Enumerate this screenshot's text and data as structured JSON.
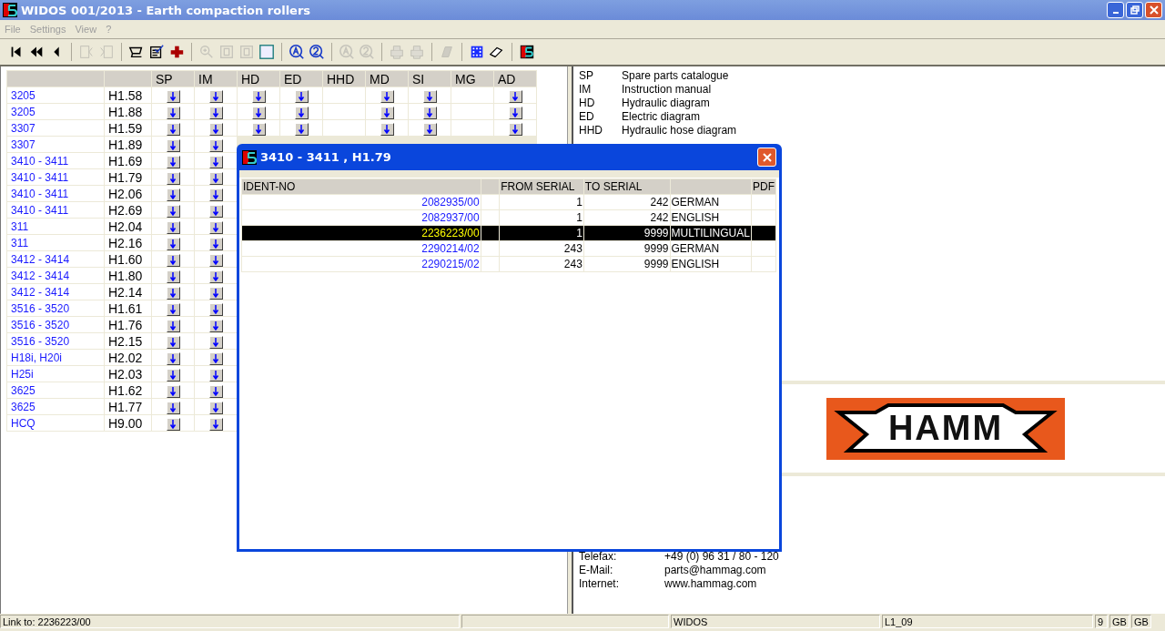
{
  "window": {
    "title": "WIDOS 001/2013 - Earth compaction rollers"
  },
  "menu": [
    {
      "label": "File",
      "disabled": true
    },
    {
      "label": "Settings",
      "disabled": true
    },
    {
      "label": "View",
      "disabled": true
    },
    {
      "label": "?",
      "disabled": true
    }
  ],
  "toolbar": [
    {
      "kind": "first",
      "disabled": false
    },
    {
      "kind": "rewind",
      "disabled": false
    },
    {
      "kind": "back",
      "disabled": false
    },
    {
      "kind": "separator"
    },
    {
      "kind": "doc-back",
      "disabled": true
    },
    {
      "kind": "doc-forward",
      "disabled": true
    },
    {
      "kind": "separator"
    },
    {
      "kind": "cart",
      "disabled": false
    },
    {
      "kind": "checklist",
      "disabled": false
    },
    {
      "kind": "cross",
      "disabled": false
    },
    {
      "kind": "separator"
    },
    {
      "kind": "zoom",
      "disabled": true
    },
    {
      "kind": "page",
      "disabled": true
    },
    {
      "kind": "page",
      "disabled": true
    },
    {
      "kind": "frame",
      "disabled": false
    },
    {
      "kind": "separator"
    },
    {
      "kind": "find-a",
      "disabled": false
    },
    {
      "kind": "find-2",
      "disabled": false
    },
    {
      "kind": "separator"
    },
    {
      "kind": "find-a",
      "disabled": true
    },
    {
      "kind": "find-2",
      "disabled": true
    },
    {
      "kind": "separator"
    },
    {
      "kind": "print",
      "disabled": true
    },
    {
      "kind": "print",
      "disabled": true
    },
    {
      "kind": "separator"
    },
    {
      "kind": "stamp",
      "disabled": true
    },
    {
      "kind": "separator"
    },
    {
      "kind": "grid",
      "disabled": false
    },
    {
      "kind": "eraser",
      "disabled": false
    },
    {
      "kind": "separator"
    },
    {
      "kind": "logo",
      "disabled": false
    }
  ],
  "machines": {
    "columns": [
      "SP",
      "IM",
      "HD",
      "ED",
      "HHD",
      "MD",
      "SI",
      "MG",
      "AD"
    ],
    "rows": [
      {
        "model": "3205",
        "version": "H1.58",
        "docs": [
          true,
          true,
          true,
          true,
          false,
          true,
          true,
          false,
          true
        ]
      },
      {
        "model": "3205",
        "version": "H1.88",
        "docs": [
          true,
          true,
          true,
          true,
          false,
          true,
          true,
          false,
          true
        ]
      },
      {
        "model": "3307",
        "version": "H1.59",
        "docs": [
          true,
          true,
          true,
          true,
          false,
          true,
          true,
          false,
          true
        ]
      },
      {
        "model": "3307",
        "version": "H1.89",
        "docs": [
          true,
          true
        ]
      },
      {
        "model": "3410 - 3411",
        "version": "H1.69",
        "docs": [
          true,
          true
        ]
      },
      {
        "model": "3410 - 3411",
        "version": "H1.79",
        "docs": [
          true,
          true
        ]
      },
      {
        "model": "3410 - 3411",
        "version": "H2.06",
        "docs": [
          true,
          true
        ]
      },
      {
        "model": "3410 - 3411",
        "version": "H2.69",
        "docs": [
          true,
          true
        ]
      },
      {
        "model": "311",
        "version": "H2.04",
        "docs": [
          true,
          true
        ]
      },
      {
        "model": "311",
        "version": "H2.16",
        "docs": [
          true,
          true
        ]
      },
      {
        "model": "3412 - 3414",
        "version": "H1.60",
        "docs": [
          true,
          true
        ]
      },
      {
        "model": "3412 - 3414",
        "version": "H1.80",
        "docs": [
          true,
          true
        ]
      },
      {
        "model": "3412 - 3414",
        "version": "H2.14",
        "docs": [
          true,
          true
        ]
      },
      {
        "model": "3516 - 3520",
        "version": "H1.61",
        "docs": [
          true,
          true
        ]
      },
      {
        "model": "3516 - 3520",
        "version": "H1.76",
        "docs": [
          true,
          true
        ]
      },
      {
        "model": "3516 - 3520",
        "version": "H2.15",
        "docs": [
          true,
          true
        ]
      },
      {
        "model": "H18i, H20i",
        "version": "H2.02",
        "docs": [
          true,
          true
        ]
      },
      {
        "model": "H25i",
        "version": "H2.03",
        "docs": [
          true,
          true
        ]
      },
      {
        "model": "3625",
        "version": "H1.62",
        "docs": [
          true,
          true
        ]
      },
      {
        "model": "3625",
        "version": "H1.77",
        "docs": [
          true,
          true
        ]
      },
      {
        "model": "HCQ",
        "version": "H9.00",
        "docs": [
          true,
          true
        ]
      }
    ]
  },
  "legend": [
    {
      "code": "SP",
      "meaning": "Spare parts catalogue"
    },
    {
      "code": "IM",
      "meaning": "Instruction manual"
    },
    {
      "code": "HD",
      "meaning": "Hydraulic diagram"
    },
    {
      "code": "ED",
      "meaning": "Electric diagram"
    },
    {
      "code": "HHD",
      "meaning": "Hydraulic hose diagram"
    }
  ],
  "logo": {
    "text": "HAMM"
  },
  "contact": [
    {
      "label": "Telefax:",
      "value": "+49 (0) 96 31 / 80 - 120"
    },
    {
      "label": "E-Mail:",
      "value": "parts@hammag.com"
    },
    {
      "label": "Internet:",
      "value": "www.hammag.com"
    }
  ],
  "dialog": {
    "title": "3410 - 3411  , H1.79",
    "columns": [
      "IDENT-NO",
      "FROM SERIAL",
      "TO SERIAL",
      "PDF"
    ],
    "rows": [
      {
        "ident": "2082935/00",
        "from": "1",
        "to": "242",
        "language": "GERMAN",
        "selected": false
      },
      {
        "ident": "2082937/00",
        "from": "1",
        "to": "242",
        "language": "ENGLISH",
        "selected": false
      },
      {
        "ident": "2236223/00",
        "from": "1",
        "to": "9999",
        "language": "MULTILINGUAL",
        "selected": true
      },
      {
        "ident": "2290214/02",
        "from": "243",
        "to": "9999",
        "language": "GERMAN",
        "selected": false
      },
      {
        "ident": "2290215/02",
        "from": "243",
        "to": "9999",
        "language": "ENGLISH",
        "selected": false
      }
    ]
  },
  "status_bar": [
    "Link to: 2236223/00",
    "WIDOS",
    "L1_09",
    "9",
    "GB",
    "GB"
  ]
}
